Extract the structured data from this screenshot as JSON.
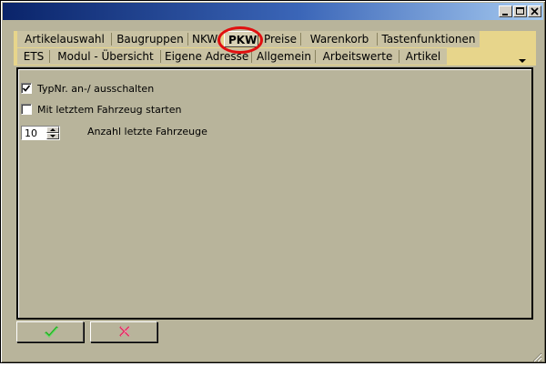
{
  "window": {
    "controls": [
      "minimize",
      "maximize",
      "close"
    ]
  },
  "tabs": {
    "row1": [
      "Artikelauswahl",
      "Baugruppen",
      "NKW",
      "PKW",
      "Preise",
      "Warenkorb",
      "Tastenfunktionen"
    ],
    "row2": [
      "ETS",
      "Modul - Übersicht",
      "Eigene Adresse",
      "Allgemein",
      "Arbeitswerte",
      "Artikel"
    ],
    "active": "PKW"
  },
  "options": {
    "typnr_label": "TypNr. an-/ ausschalten",
    "typnr_checked": true,
    "letzte_label": "Mit letztem Fahrzeug starten",
    "letzte_checked": false,
    "anzahl_value": "10",
    "anzahl_label": "Anzahl letzte Fahrzeuge"
  },
  "colors": {
    "ok_check": "#20b020",
    "cancel_x": "#e03060",
    "highlight": "#e01010"
  }
}
